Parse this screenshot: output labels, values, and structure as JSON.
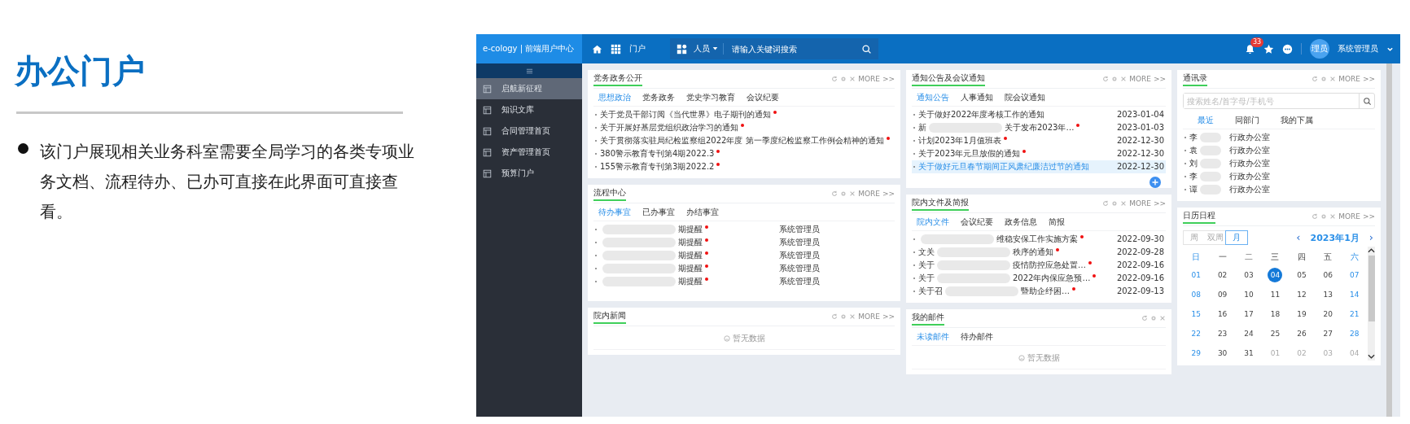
{
  "slide": {
    "title": "办公门户",
    "bullet": "该门户展现相关业务科室需要全局学习的各类专项业务文档、流程待办、已办可直接在此界面可直接查看。"
  },
  "topbar": {
    "brand": "e-cology | 前端用户中心",
    "nav": "门户",
    "search_scope": "人员",
    "search_placeholder": "请输入关键词搜索",
    "badge": "33",
    "avatar": "理员",
    "user": "系统管理员"
  },
  "sidebar": {
    "items": [
      {
        "label": "启航新征程",
        "selected": true
      },
      {
        "label": "知识文库",
        "selected": false
      },
      {
        "label": "合同管理首页",
        "selected": false
      },
      {
        "label": "资产管理首页",
        "selected": false
      },
      {
        "label": "预算门户",
        "selected": false
      }
    ]
  },
  "columns": [
    {
      "panels": [
        {
          "title": "党务政务公开",
          "more": "MORE >>",
          "tabs": [
            {
              "label": "思想政治",
              "selected": true
            },
            {
              "label": "党务政务",
              "selected": false
            },
            {
              "label": "党史学习教育",
              "selected": false
            },
            {
              "label": "会议纪要",
              "selected": false
            }
          ],
          "rows": [
            {
              "head": "关于党员干部订阅《当代世界》电子期刊的通知",
              "dot": true
            },
            {
              "head": "关于开展好基层党组织政治学习的通知",
              "dot": true
            },
            {
              "head": "关于贯彻落实驻局纪检监察组2022年度 第一季度纪检监察工作例会精神的通知",
              "dot": true
            },
            {
              "head": "380警示教育专刊第4期2022.3",
              "dot": true
            },
            {
              "head": "155警示教育专刊第3期2022.2",
              "dot": true
            }
          ]
        },
        {
          "title": "流程中心",
          "more": "MORE >>",
          "tabs": [
            {
              "label": "待办事宜",
              "selected": true
            },
            {
              "label": "已办事宜",
              "selected": false
            },
            {
              "label": "办结事宜",
              "selected": false
            }
          ],
          "rows": [
            {
              "redacted": true,
              "tail": "期提醒",
              "dot": true,
              "meta": "系统管理员"
            },
            {
              "redacted": true,
              "tail": "期提醒",
              "dot": true,
              "meta": "系统管理员"
            },
            {
              "redacted": true,
              "tail": "期提醒",
              "dot": true,
              "meta": "系统管理员"
            },
            {
              "redacted": true,
              "tail": "期提醒",
              "dot": true,
              "meta": "系统管理员"
            },
            {
              "redacted": true,
              "tail": "期提醒",
              "dot": true,
              "meta": "系统管理员"
            }
          ]
        },
        {
          "title": "院内新闻",
          "more": "MORE >>",
          "empty": "暂无数据"
        }
      ]
    },
    {
      "panels": [
        {
          "title": "通知公告及会议通知",
          "more": "MORE >>",
          "add": true,
          "tabs": [
            {
              "label": "通知公告",
              "selected": true
            },
            {
              "label": "人事通知",
              "selected": false
            },
            {
              "label": "院会议通知",
              "selected": false
            }
          ],
          "rows": [
            {
              "head": "关于做好2022年度考核工作的通知",
              "dot": false,
              "meta": "2023-01-04",
              "highlighted": false
            },
            {
              "head": "新",
              "redacted": true,
              "tail": "关于发布2023年…",
              "dot": true,
              "meta": "2023-01-03",
              "highlighted": false
            },
            {
              "head": "计划2023年1月值班表",
              "dot": true,
              "meta": "2022-12-30",
              "highlighted": false
            },
            {
              "head": "关于2023年元旦放假的通知",
              "dot": true,
              "meta": "2022-12-30",
              "highlighted": false
            },
            {
              "head": "关于做好元旦春节期间正风肃纪廉洁过节的通知",
              "dot": false,
              "meta": "2022-12-30",
              "highlighted": true
            }
          ]
        },
        {
          "title": "院内文件及简报",
          "more": "MORE >>",
          "tabs": [
            {
              "label": "院内文件",
              "selected": true
            },
            {
              "label": "会议纪要",
              "selected": false
            },
            {
              "label": "政务信息",
              "selected": false
            },
            {
              "label": "简报",
              "selected": false
            }
          ],
          "rows": [
            {
              "redacted": true,
              "tail": "维稳安保工作实施方案",
              "dot": true,
              "meta": "2022-09-30"
            },
            {
              "head": "文关",
              "redacted": true,
              "tail": "秩序的通知",
              "dot": true,
              "meta": "2022-09-28"
            },
            {
              "head": "关于",
              "redacted": true,
              "tail": "疫情防控应急处置…",
              "dot": true,
              "meta": "2022-09-16"
            },
            {
              "head": "关于",
              "redacted": true,
              "tail": "2022年内保应急预…",
              "dot": true,
              "meta": "2022-09-16"
            },
            {
              "head": "关于召",
              "redacted": true,
              "tail": "暨助企纾困…",
              "dot": true,
              "meta": "2022-09-13"
            }
          ]
        },
        {
          "title": "我的邮件",
          "tabs": [
            {
              "label": "未读邮件",
              "selected": true
            },
            {
              "label": "待办邮件",
              "selected": false
            }
          ],
          "empty": "暂无数据"
        }
      ]
    }
  ],
  "contacts": {
    "title": "通讯录",
    "more": "MORE >>",
    "search_placeholder": "搜索姓名/首字母/手机号",
    "tabs": [
      {
        "label": "最近",
        "selected": true
      },
      {
        "label": "同部门",
        "selected": false
      },
      {
        "label": "我的下属",
        "selected": false
      }
    ],
    "rows": [
      {
        "head": "李",
        "redacted": true,
        "tail": "行政办公室"
      },
      {
        "head": "袁",
        "redacted": true,
        "tail": "行政办公室"
      },
      {
        "head": "刘",
        "redacted": true,
        "tail": "行政办公室"
      },
      {
        "head": "李",
        "redacted": true,
        "tail": "行政办公室"
      },
      {
        "head": "谭",
        "redacted": true,
        "tail": "行政办公室"
      }
    ]
  },
  "calendar": {
    "title": "日历日程",
    "more": "MORE >>",
    "views": [
      {
        "label": "周",
        "selected": false
      },
      {
        "label": "双周",
        "selected": false
      },
      {
        "label": "月",
        "selected": true
      }
    ],
    "month": "2023年1月",
    "prev": "‹",
    "next": "›",
    "weekdays": [
      {
        "label": "日",
        "kind": "weekend"
      },
      {
        "label": "一",
        "kind": "weekday"
      },
      {
        "label": "二",
        "kind": "weekday"
      },
      {
        "label": "三",
        "kind": "weekday"
      },
      {
        "label": "四",
        "kind": "weekday"
      },
      {
        "label": "五",
        "kind": "weekday"
      },
      {
        "label": "六",
        "kind": "weekend"
      }
    ],
    "days": [
      {
        "label": "01",
        "kind": "weekend",
        "selected": false
      },
      {
        "label": "02",
        "kind": "weekday",
        "selected": false
      },
      {
        "label": "03",
        "kind": "weekday",
        "selected": false
      },
      {
        "label": "04",
        "kind": "weekday",
        "selected": true
      },
      {
        "label": "05",
        "kind": "weekday",
        "selected": false
      },
      {
        "label": "06",
        "kind": "weekday",
        "selected": false
      },
      {
        "label": "07",
        "kind": "weekend",
        "selected": false
      },
      {
        "label": "08",
        "kind": "weekend",
        "selected": false
      },
      {
        "label": "09",
        "kind": "weekday",
        "selected": false
      },
      {
        "label": "10",
        "kind": "weekday",
        "selected": false
      },
      {
        "label": "11",
        "kind": "weekday",
        "selected": false
      },
      {
        "label": "12",
        "kind": "weekday",
        "selected": false
      },
      {
        "label": "13",
        "kind": "weekday",
        "selected": false
      },
      {
        "label": "14",
        "kind": "weekend",
        "selected": false
      },
      {
        "label": "15",
        "kind": "weekend",
        "selected": false
      },
      {
        "label": "16",
        "kind": "weekday",
        "selected": false
      },
      {
        "label": "17",
        "kind": "weekday",
        "selected": false
      },
      {
        "label": "18",
        "kind": "weekday",
        "selected": false
      },
      {
        "label": "19",
        "kind": "weekday",
        "selected": false
      },
      {
        "label": "20",
        "kind": "weekday",
        "selected": false
      },
      {
        "label": "21",
        "kind": "weekend",
        "selected": false
      },
      {
        "label": "22",
        "kind": "weekend",
        "selected": false
      },
      {
        "label": "23",
        "kind": "weekday",
        "selected": false
      },
      {
        "label": "24",
        "kind": "weekday",
        "selected": false
      },
      {
        "label": "25",
        "kind": "weekday",
        "selected": false
      },
      {
        "label": "26",
        "kind": "weekday",
        "selected": false
      },
      {
        "label": "27",
        "kind": "weekday",
        "selected": false
      },
      {
        "label": "28",
        "kind": "weekend",
        "selected": false
      },
      {
        "label": "29",
        "kind": "weekend",
        "selected": false
      },
      {
        "label": "30",
        "kind": "weekday",
        "selected": false
      },
      {
        "label": "31",
        "kind": "weekday",
        "selected": false
      },
      {
        "label": "01",
        "kind": "other",
        "selected": false
      },
      {
        "label": "02",
        "kind": "other",
        "selected": false
      },
      {
        "label": "03",
        "kind": "other",
        "selected": false
      },
      {
        "label": "04",
        "kind": "other",
        "selected": false
      }
    ]
  }
}
